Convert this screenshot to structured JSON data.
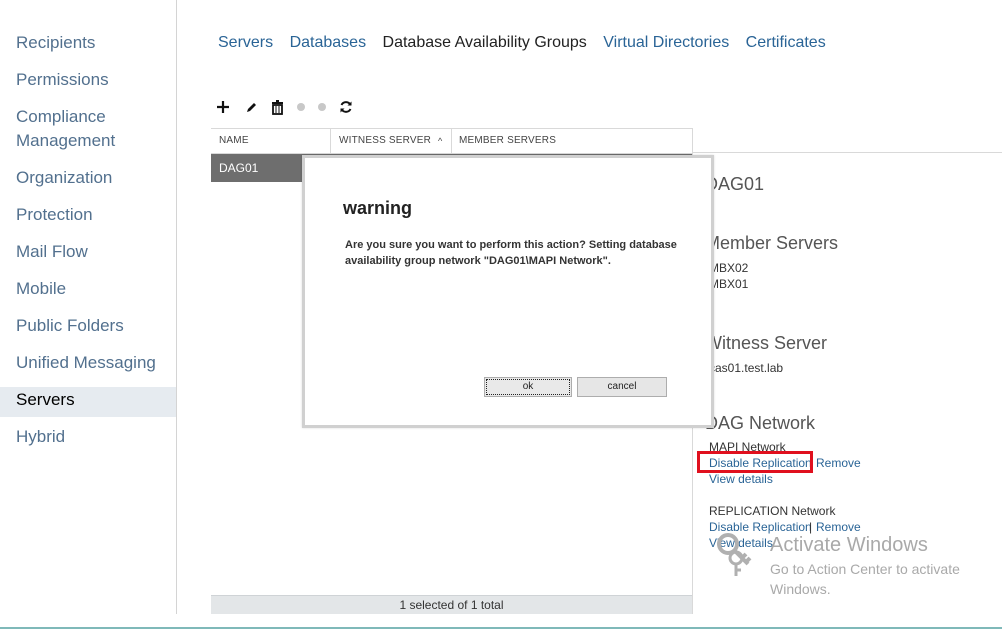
{
  "nav": {
    "items": [
      {
        "label": "Recipients"
      },
      {
        "label": "Permissions"
      },
      {
        "label": "Compliance\nManagement"
      },
      {
        "label": "Organization"
      },
      {
        "label": "Protection"
      },
      {
        "label": "Mail Flow"
      },
      {
        "label": "Mobile"
      },
      {
        "label": "Public Folders"
      },
      {
        "label": "Unified Messaging"
      },
      {
        "label": "Servers"
      },
      {
        "label": "Hybrid"
      }
    ],
    "selected": "Servers"
  },
  "tabs": [
    {
      "label": "Servers"
    },
    {
      "label": "Databases"
    },
    {
      "label": "Database Availability Groups"
    },
    {
      "label": "Virtual Directories"
    },
    {
      "label": "Certificates"
    }
  ],
  "toolbar": {
    "icons": [
      "add-icon",
      "edit-icon",
      "delete-icon",
      "disabled-dot-icon",
      "disabled-dot-icon",
      "refresh-icon"
    ]
  },
  "grid": {
    "columns": [
      "NAME",
      "WITNESS SERVER",
      "MEMBER SERVERS"
    ],
    "sort_indicator": "^",
    "rows": [
      {
        "name": "DAG01"
      }
    ],
    "status": "1 selected of 1 total"
  },
  "details": {
    "title": "DAG01",
    "member_servers_heading": "Member Servers",
    "member_servers": [
      "MBX02",
      "MBX01"
    ],
    "witness_heading": "Witness Server",
    "witness_value": "cas01.test.lab",
    "dag_network_heading": "DAG Network",
    "networks": [
      {
        "name": "MAPI Network",
        "disable": "Disable Replication",
        "sep": "|",
        "remove": "Remove",
        "view": "View details"
      },
      {
        "name": "REPLICATION Network",
        "disable": "Disable Replication",
        "sep": "|",
        "remove": "Remove",
        "view": "View details"
      }
    ]
  },
  "dialog": {
    "title": "warning",
    "message": "Are you sure you want to perform this action? Setting database availability group network \"DAG01\\MAPI Network\".",
    "ok_label": "ok",
    "cancel_label": "cancel"
  },
  "watermark": {
    "title": "Activate Windows",
    "subtitle": "Go to Action Center to activate Windows."
  },
  "colors": {
    "link": "#2a6496",
    "nav_text": "#52708e",
    "selected_row": "#6e6e6e",
    "highlight": "#e0101e"
  }
}
